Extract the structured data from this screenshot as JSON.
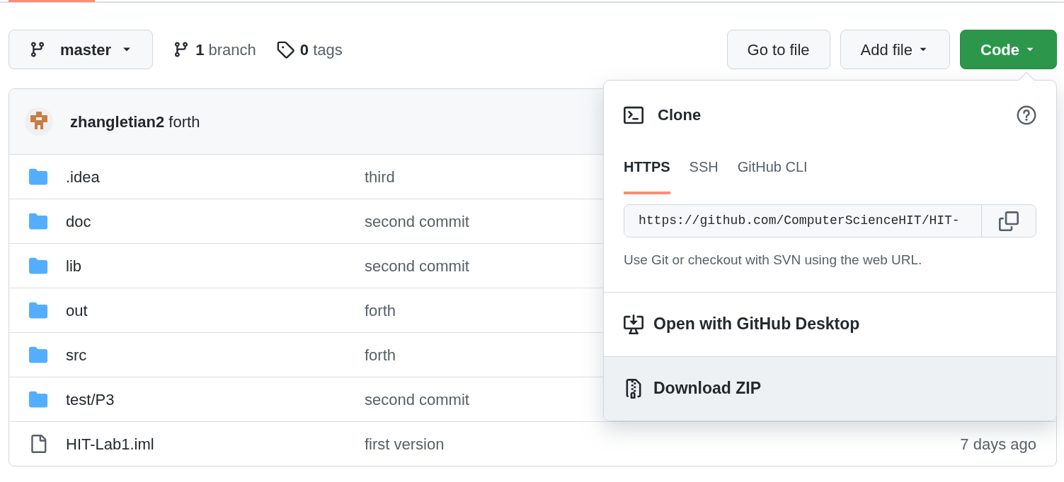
{
  "branch_selector": {
    "label": "master"
  },
  "branches": {
    "count": "1",
    "label": "branch"
  },
  "tags": {
    "count": "0",
    "label": "tags"
  },
  "buttons": [
    {
      "label": "Go to file",
      "kind": "plain"
    },
    {
      "label": "Add file",
      "kind": "dropdown"
    },
    {
      "label": "Code",
      "kind": "primary"
    }
  ],
  "latest_commit": {
    "author": "zhangletian2",
    "message": "forth"
  },
  "files": [
    {
      "name": ".idea",
      "kind": "folder",
      "message": "third"
    },
    {
      "name": "doc",
      "kind": "folder",
      "message": "second commit"
    },
    {
      "name": "lib",
      "kind": "folder",
      "message": "second commit"
    },
    {
      "name": "out",
      "kind": "folder",
      "message": "forth"
    },
    {
      "name": "src",
      "kind": "folder",
      "message": "forth"
    },
    {
      "name": "test/P3",
      "kind": "folder",
      "message": "second commit"
    },
    {
      "name": "HIT-Lab1.iml",
      "kind": "file",
      "message": "first version",
      "time": "7 days ago"
    }
  ],
  "clone_menu": {
    "title": "Clone",
    "tabs": [
      {
        "label": "HTTPS",
        "selected": true
      },
      {
        "label": "SSH",
        "selected": false
      },
      {
        "label": "GitHub CLI",
        "selected": false
      }
    ],
    "url": "https://github.com/ComputerScienceHIT/HIT-",
    "hint": "Use Git or checkout with SVN using the web URL.",
    "items": [
      {
        "label": "Open with GitHub Desktop",
        "kind": "desktop",
        "highlighted": false
      },
      {
        "label": "Download ZIP",
        "kind": "zip",
        "highlighted": true
      }
    ]
  }
}
